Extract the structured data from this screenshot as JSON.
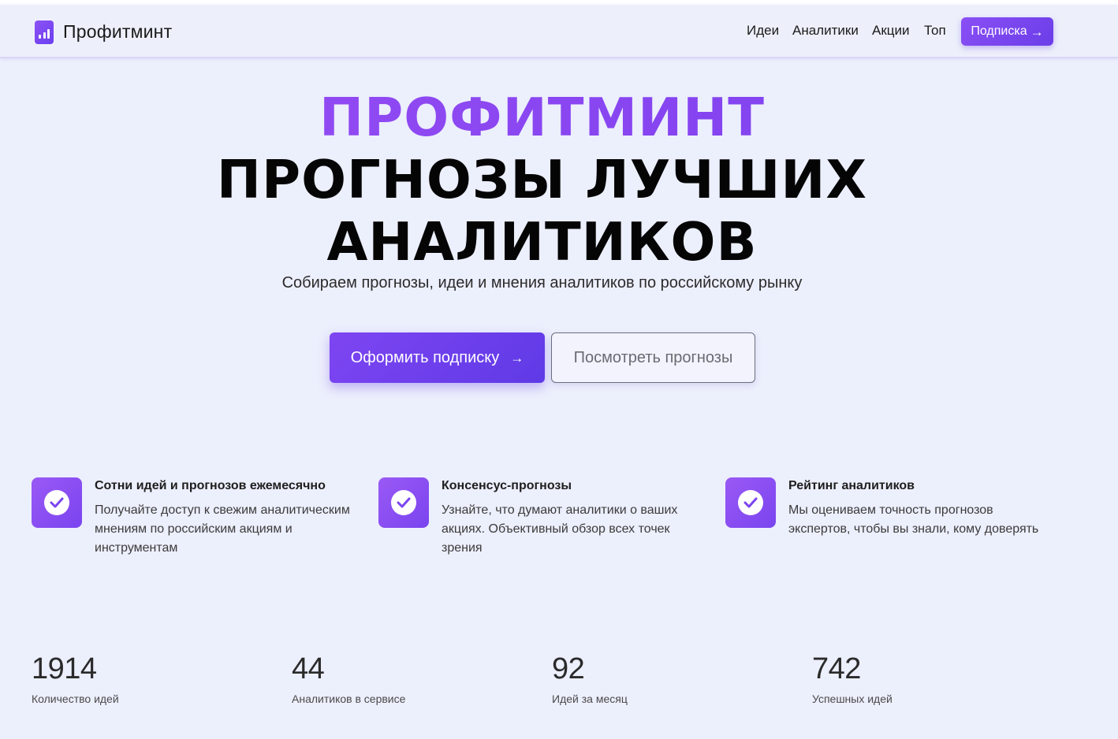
{
  "header": {
    "brand": "Профитминт",
    "nav": [
      "Идеи",
      "Аналитики",
      "Акции",
      "Топ"
    ],
    "subscribe_label": "Подписка",
    "arrow_icon": "arrow-right-icon"
  },
  "hero": {
    "brand": "ПРОФИТМИНТ",
    "line1": "ПРОГНОЗЫ ЛУЧШИХ",
    "line2": "АНАЛИТИКОВ",
    "subtitle": "Собираем прогнозы, идеи и мнения аналитиков по российскому рынку",
    "primary_cta": "Оформить подписку",
    "secondary_cta": "Посмотреть прогнозы"
  },
  "features": [
    {
      "icon": "check-circle-icon",
      "title": "Сотни идей и прогнозов ежемесячно",
      "text": "Получайте доступ к свежим аналитическим мнениям по российским акциям и инструментам"
    },
    {
      "icon": "check-circle-icon",
      "title": "Консенсус-прогнозы",
      "text": "Узнайте, что думают аналитики о ваших акциях. Объективный обзор всех точек зрения"
    },
    {
      "icon": "check-circle-icon",
      "title": "Рейтинг аналитиков",
      "text": "Мы оцениваем точность прогнозов экспертов, чтобы вы знали, кому доверять"
    }
  ],
  "stats": [
    {
      "value": "1914",
      "label": "Количество идей"
    },
    {
      "value": "44",
      "label": "Аналитиков в сервисе"
    },
    {
      "value": "92",
      "label": "Идей за месяц"
    },
    {
      "value": "742",
      "label": "Успешных идей"
    }
  ],
  "colors": {
    "accent": "#7b44f0",
    "background": "#eceffc",
    "text": "#1a1a1a"
  }
}
